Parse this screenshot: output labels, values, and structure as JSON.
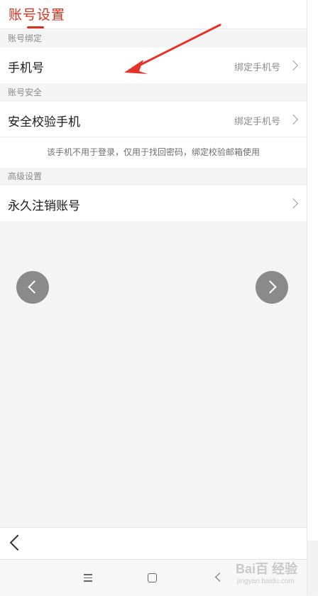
{
  "header": {
    "title": "账号设置"
  },
  "sections": {
    "binding": {
      "label": "账号绑定",
      "phone_row": {
        "label": "手机号",
        "value": "绑定手机号"
      }
    },
    "security": {
      "label": "账号安全",
      "verify_row": {
        "label": "安全校验手机",
        "value": "绑定手机号"
      },
      "note": "该手机不用于登录，仅用于找回密码，绑定校验邮箱使用"
    },
    "advanced": {
      "label": "高级设置",
      "cancel_row": {
        "label": "永久注销账号"
      }
    }
  },
  "annotation": {
    "color": "#e53228"
  },
  "accent_color": "#d8321f",
  "watermark": {
    "text": "Bai百 经验",
    "sub": "jingyan.baidu.com"
  }
}
